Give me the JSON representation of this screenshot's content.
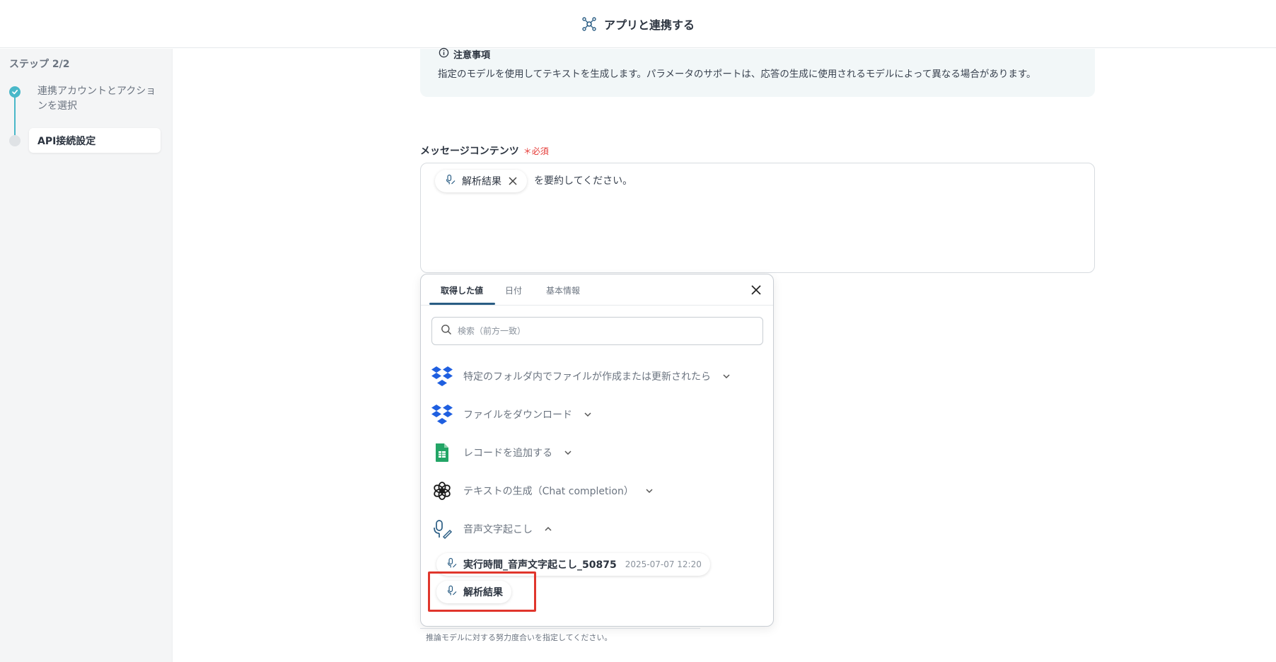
{
  "header": {
    "title": "アプリと連携する",
    "icon": "connect-icon"
  },
  "sidebar": {
    "step_label": "ステップ 2/2",
    "steps": [
      {
        "label": "連携アカウントとアクションを選択",
        "status": "done"
      },
      {
        "label": "API接続設定",
        "status": "current"
      }
    ]
  },
  "note": {
    "title": "注意事項",
    "body": "指定のモデルを使用してテキストを生成します。パラメータのサポートは、応答の生成に使用されるモデルによって異なる場合があります。"
  },
  "message_field": {
    "label": "メッセージコンテンツ",
    "required_mark": "＊",
    "required_text": "必須",
    "chip_label": "解析結果",
    "text_after_chip": "を要約してください。"
  },
  "panel": {
    "tabs": [
      "取得した値",
      "日付",
      "基本情報"
    ],
    "active_tab": 0,
    "search_placeholder": "検索（前方一致）",
    "groups": [
      {
        "label": "特定のフォルダ内でファイルが作成または更新されたら",
        "icon": "dropbox-icon",
        "expanded": false
      },
      {
        "label": "ファイルをダウンロード",
        "icon": "dropbox-icon",
        "expanded": false
      },
      {
        "label": "レコードを追加する",
        "icon": "google-sheets-icon",
        "expanded": false
      },
      {
        "label": "テキストの生成（Chat completion）",
        "icon": "openai-icon",
        "expanded": false
      },
      {
        "label": "音声文字起こし",
        "icon": "microphone-icon",
        "expanded": true
      }
    ],
    "items": [
      {
        "label": "実行時間_音声文字起こし_50875",
        "date": "2025-07-07 12:20"
      },
      {
        "label": "解析結果",
        "date": ""
      }
    ]
  },
  "hint": "推論モデルに対する努力度合いを指定してください。",
  "colors": {
    "accent": "#49b8c9",
    "tab_underline": "#2a5d84",
    "highlight": "#e0362c",
    "required": "#e53935"
  }
}
